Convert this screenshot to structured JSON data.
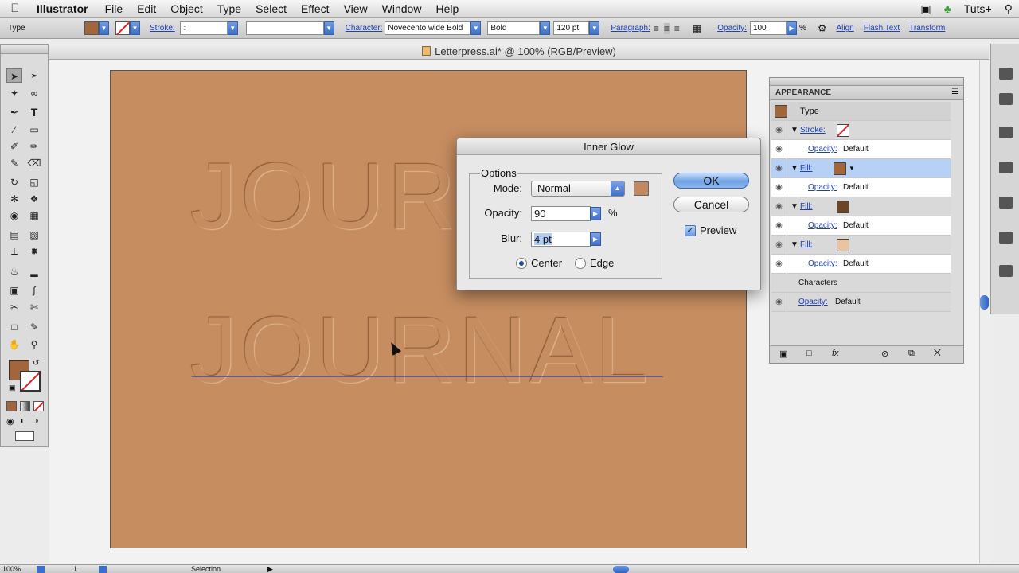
{
  "menubar": {
    "app_name": "Illustrator",
    "items": [
      "File",
      "Edit",
      "Object",
      "Type",
      "Select",
      "Effect",
      "View",
      "Window",
      "Help"
    ],
    "right_label": "Tuts+"
  },
  "controlbar": {
    "selection_type": "Type",
    "fill_color": "#a2663c",
    "stroke_label": "Stroke:",
    "character_label": "Character:",
    "font_family": "Novecento wide Bold",
    "font_style": "Bold",
    "font_size": "120 pt",
    "paragraph_label": "Paragraph:",
    "opacity_label": "Opacity:",
    "opacity_value": "100",
    "opacity_unit": "%",
    "align_label": "Align",
    "flash_text_label": "Flash Text",
    "transform_label": "Transform"
  },
  "document": {
    "tab_title": "Letterpress.ai* @ 100% (RGB/Preview)",
    "artboard_color": "#c68d61",
    "text_top": "JOUR",
    "text_bottom": "JOURNAL"
  },
  "dialog": {
    "title": "Inner Glow",
    "options_label": "Options",
    "mode_label": "Mode:",
    "mode_value": "Normal",
    "glow_color": "#c48860",
    "opacity_label": "Opacity:",
    "opacity_value": "90",
    "opacity_unit": "%",
    "blur_label": "Blur:",
    "blur_value": "4 pt",
    "center_label": "Center",
    "edge_label": "Edge",
    "center_selected": true,
    "ok_label": "OK",
    "cancel_label": "Cancel",
    "preview_label": "Preview",
    "preview_checked": true
  },
  "appearance": {
    "panel_title": "APPEARANCE",
    "object_type": "Type",
    "stroke_label": "Stroke:",
    "fill_label": "Fill:",
    "opacity_label": "Opacity:",
    "opacity_value": "Default",
    "characters_label": "Characters",
    "fill_colors": [
      "#a2663c",
      "#6b4527",
      "#e8c4a0"
    ]
  },
  "statusbar": {
    "zoom": "100%",
    "page": "1",
    "tool": "Selection"
  }
}
